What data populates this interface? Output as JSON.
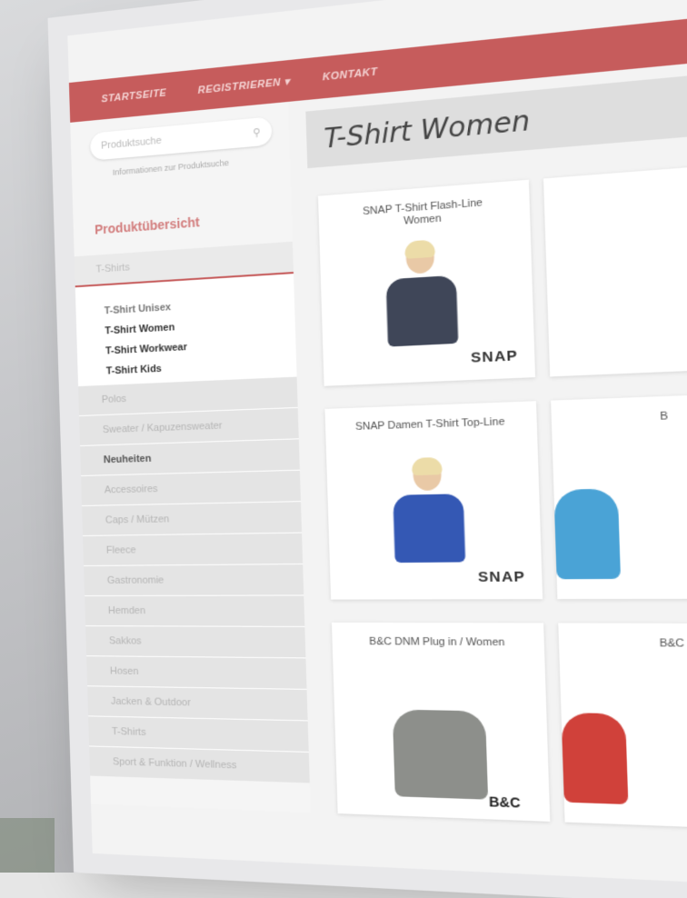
{
  "nav": {
    "items": [
      "Startseite",
      "Registrieren ▾",
      "Kontakt"
    ]
  },
  "search": {
    "placeholder": "Produktsuche",
    "hint": "Informationen zur Produktsuche"
  },
  "sidebar": {
    "section_title": "Produktübersicht",
    "category_open": "T-Shirts",
    "subcategories": [
      "T-Shirt Unisex",
      "T-Shirt Women",
      "T-Shirt Workwear",
      "T-Shirt Kids"
    ],
    "categories": [
      "Polos",
      "Sweater / Kapuzensweater",
      "Neuheiten",
      "Accessoires",
      "Caps / Mützen",
      "Fleece",
      "Gastronomie",
      "Hemden",
      "Sakkos",
      "Hosen",
      "Jacken & Outdoor",
      "T-Shirts",
      "Sport & Funktion / Wellness"
    ]
  },
  "main": {
    "title": "T-Shirt Women",
    "products": [
      {
        "name": "SNAP T-Shirt Flash-Line Women",
        "brand": "SNAP",
        "color": "#3f4658"
      },
      {
        "name": "",
        "brand": "",
        "color": "#f0f0f0"
      },
      {
        "name": "SNAP Damen T-Shirt Top-Line",
        "brand": "SNAP",
        "color": "#3458b4"
      },
      {
        "name": "B",
        "brand": "",
        "color": "#4aa3d6"
      },
      {
        "name": "B&C DNM Plug in / Women",
        "brand": "B&C",
        "color": "#8d8f8b"
      },
      {
        "name": "B&C",
        "brand": "",
        "color": "#d0413a"
      }
    ]
  }
}
